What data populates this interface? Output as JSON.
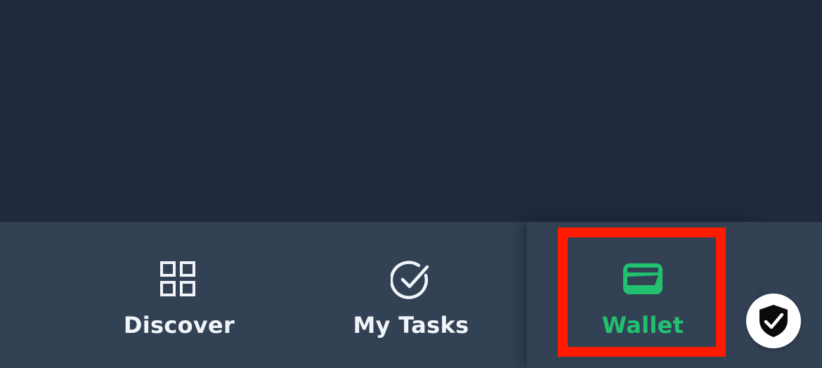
{
  "tabbar": {
    "tabs": [
      {
        "id": "discover",
        "label": "Discover",
        "icon": "grid-icon",
        "active": false
      },
      {
        "id": "my-tasks",
        "label": "My Tasks",
        "icon": "check-circle-icon",
        "active": false
      },
      {
        "id": "wallet",
        "label": "Wallet",
        "icon": "wallet-icon",
        "active": true
      }
    ]
  },
  "floating_button": {
    "icon": "shield-check-icon"
  },
  "colors": {
    "background": "#202a3d",
    "tabbar": "#334155",
    "inactive_text": "#f1f5f9",
    "active_accent": "#22c16f",
    "highlight": "#ff1a00",
    "fab_background": "#ffffff"
  }
}
